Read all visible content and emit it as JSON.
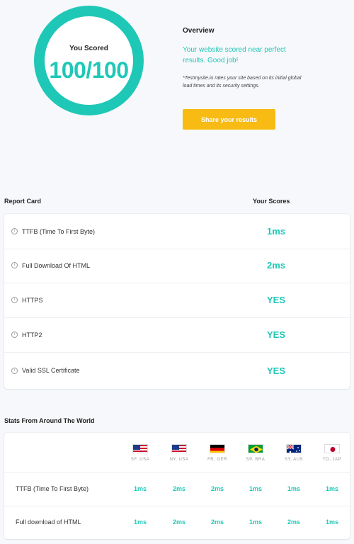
{
  "score": {
    "label": "You Scored",
    "value": "100/100",
    "accent": "#1fc8b6"
  },
  "overview": {
    "title": "Overview",
    "message": "Your website scored near perfect results. Good job!",
    "note": "*Testmysite.io rates your site based on its initial global load times and its security settings.",
    "share_label": "Share your results",
    "button_color": "#f7bb13"
  },
  "report": {
    "title": "Report Card",
    "scores_header": "Your Scores",
    "info_icon": "info-icon",
    "rows": [
      {
        "label": "TTFB (Time To First Byte)",
        "value": "1ms"
      },
      {
        "label": "Full Download Of HTML",
        "value": "2ms"
      },
      {
        "label": "HTTPS",
        "value": "YES"
      },
      {
        "label": "HTTP2",
        "value": "YES"
      },
      {
        "label": "Valid SSL Certificate",
        "value": "YES"
      }
    ]
  },
  "world": {
    "title": "Stats From Around The World",
    "locations": [
      {
        "city": "SF, USA",
        "flag": "us-flag-icon"
      },
      {
        "city": "NY, USA",
        "flag": "us-flag-icon"
      },
      {
        "city": "FR, GER",
        "flag": "germany-flag-icon"
      },
      {
        "city": "SP, BRA",
        "flag": "brazil-flag-icon"
      },
      {
        "city": "SY, AUS",
        "flag": "australia-flag-icon"
      },
      {
        "city": "TO, JAP",
        "flag": "japan-flag-icon"
      }
    ],
    "rows": [
      {
        "label": "TTFB (Time To First Byte)",
        "values": [
          "1ms",
          "2ms",
          "2ms",
          "1ms",
          "1ms",
          "1ms"
        ]
      },
      {
        "label": "Full download of HTML",
        "values": [
          "1ms",
          "2ms",
          "2ms",
          "1ms",
          "2ms",
          "1ms"
        ]
      }
    ]
  }
}
